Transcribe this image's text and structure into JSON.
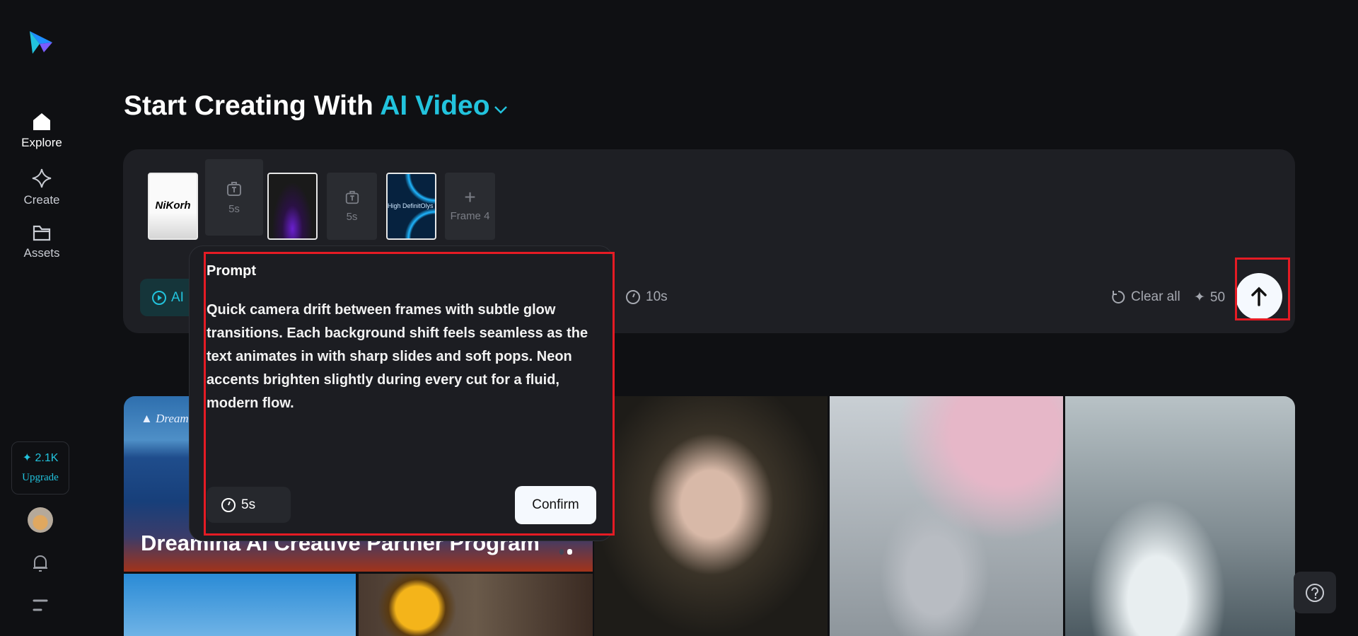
{
  "sidebar": {
    "items": [
      {
        "label": "Explore",
        "icon": "home-icon"
      },
      {
        "label": "Create",
        "icon": "sparkle-icon"
      },
      {
        "label": "Assets",
        "icon": "folder-icon"
      }
    ],
    "credits": "2.1K",
    "upgrade": "Upgrade"
  },
  "header": {
    "title_prefix": "Start Creating With",
    "title_accent": "AI Video"
  },
  "composer": {
    "frames": [
      {
        "type": "image",
        "text": "NiKorh"
      },
      {
        "type": "text",
        "duration": "5s"
      },
      {
        "type": "image",
        "text": ""
      },
      {
        "type": "text",
        "duration": "5s"
      },
      {
        "type": "image",
        "text": "High DefinitOlys"
      },
      {
        "type": "add",
        "label": "Frame 4"
      }
    ],
    "mode_label": "AI",
    "total_duration": "10s",
    "clear_all": "Clear all",
    "cost": "50"
  },
  "popover": {
    "title": "Prompt",
    "text": "Quick camera drift between frames with subtle glow transitions. Each background shift feels seamless as the text animates in with sharp slides and soft pops. Neon accents brighten slightly during every cut for a fluid, modern flow.",
    "duration": "5s",
    "confirm": "Confirm"
  },
  "gallery": {
    "banner_brand": "Dreamina",
    "banner_title": "Dreamina AI Creative Partner Program"
  },
  "colors": {
    "accent": "#22c3dd",
    "highlight": "#e51b24",
    "panel": "#1e1f24"
  }
}
